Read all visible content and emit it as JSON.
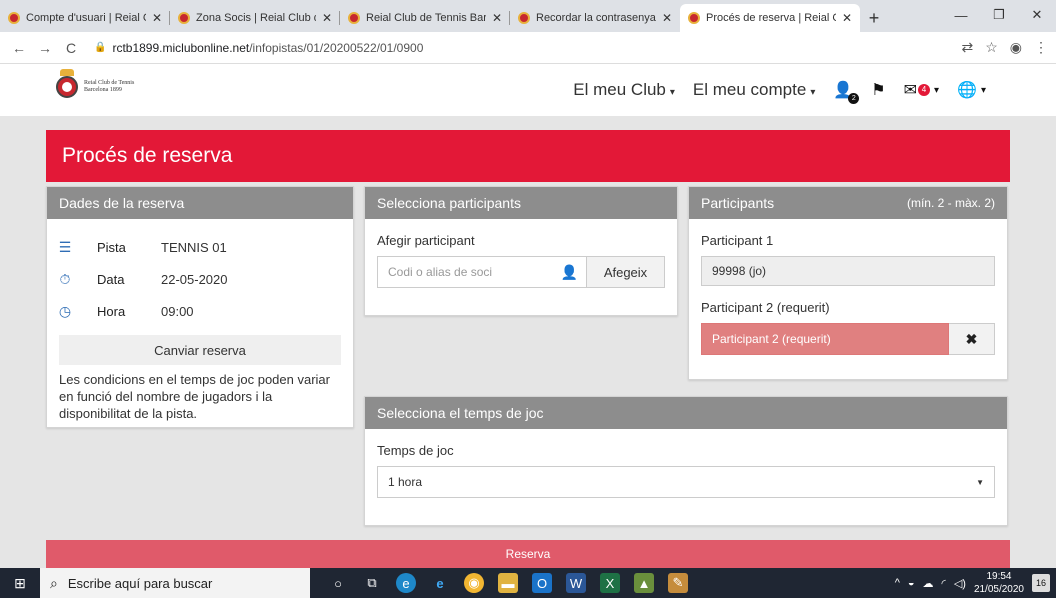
{
  "browser": {
    "tabs": [
      {
        "title": "Compte d'usuari | Reial Clul",
        "active": false
      },
      {
        "title": "Zona Socis | Reial Club de T",
        "active": false
      },
      {
        "title": "Reial Club de Tennis Barcelo",
        "active": false
      },
      {
        "title": "Recordar la contrasenya | R",
        "active": false
      },
      {
        "title": "Procés de reserva | Reial Cl",
        "active": true
      }
    ],
    "url_host": "rctb1899.miclubonline.net",
    "url_path": "/infopistas/01/20200522/01/0900"
  },
  "site": {
    "logo_line1": "Reial Club de Tennis",
    "logo_line2": "Barcelona 1899",
    "nav_club": "El meu Club",
    "nav_account": "El meu compte",
    "user_badge": "2",
    "mail_badge": "4"
  },
  "page": {
    "title": "Procés de reserva"
  },
  "dades": {
    "header": "Dades de la reserva",
    "pista_label": "Pista",
    "pista_value": "TENNIS 01",
    "data_label": "Data",
    "data_value": "22-05-2020",
    "hora_label": "Hora",
    "hora_value": "09:00",
    "change_button": "Canviar reserva",
    "note": "Les condicions en el temps de joc poden variar en funció del nombre de jugadors i la disponibilitat de la pista."
  },
  "select_participants": {
    "header": "Selecciona participants",
    "add_label": "Afegir participant",
    "input_placeholder": "Codi o alias de soci",
    "add_button": "Afegeix"
  },
  "participants": {
    "header": "Participants",
    "limits": "(mín. 2 - màx. 2)",
    "p1_label": "Participant 1",
    "p1_value": "99998 (jo)",
    "p2_label": "Participant 2 (requerit)",
    "p2_placeholder": "Participant 2 (requerit)",
    "remove_symbol": "✖"
  },
  "temps": {
    "header": "Selecciona el temps de joc",
    "label": "Temps de joc",
    "selected": "1 hora"
  },
  "reserva_button": "Reserva",
  "taskbar": {
    "search_placeholder": "Escribe aquí para buscar",
    "time": "19:54",
    "date": "21/05/2020",
    "notifications": "16"
  }
}
